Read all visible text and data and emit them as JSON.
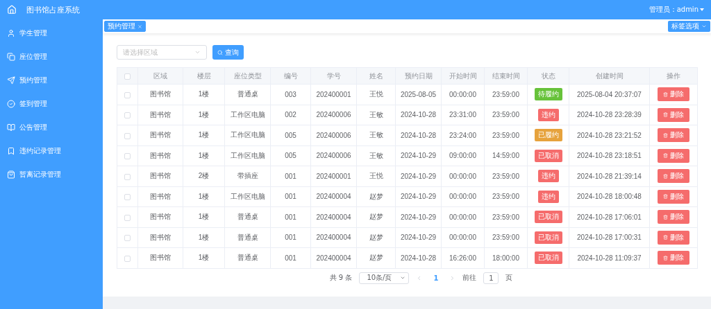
{
  "header": {
    "title": "图书馆占座系统",
    "user": "管理员：admin"
  },
  "sidebar": {
    "items": [
      {
        "label": "学生管理"
      },
      {
        "label": "座位管理"
      },
      {
        "label": "预约管理"
      },
      {
        "label": "签到管理"
      },
      {
        "label": "公告管理"
      },
      {
        "label": "违约记录管理"
      },
      {
        "label": "暂离记录管理"
      }
    ]
  },
  "tabs": [
    {
      "label": "预约管理",
      "selected": true
    }
  ],
  "tab_options": "标签选项",
  "filter": {
    "placeholder": "请选择区域",
    "search_button": "查询"
  },
  "table": {
    "header_checked": false,
    "columns": [
      "区域",
      "楼层",
      "座位类型",
      "编号",
      "学号",
      "姓名",
      "预约日期",
      "开始时间",
      "结束时间",
      "状态",
      "创建时间",
      "操作"
    ],
    "rows": [
      {
        "checked": false,
        "cells": [
          "图书馆",
          "1楼",
          "普通桌",
          "003",
          "202400001",
          "王悦",
          "2025-08-05",
          "00:00:00",
          "23:59:00"
        ],
        "status": "待履约",
        "color": "#67c23a",
        "created": "2025-08-04 20:37:07",
        "action": "删除"
      },
      {
        "checked": false,
        "cells": [
          "图书馆",
          "1楼",
          "工作区电脑",
          "002",
          "202400006",
          "王敏",
          "2024-10-28",
          "23:31:00",
          "23:59:00"
        ],
        "status": "违约",
        "color": "#f56c6c",
        "created": "2024-10-28 23:28:39",
        "action": "删除"
      },
      {
        "checked": false,
        "cells": [
          "图书馆",
          "1楼",
          "工作区电脑",
          "005",
          "202400006",
          "王敏",
          "2024-10-28",
          "23:24:00",
          "23:59:00"
        ],
        "status": "已履约",
        "color": "#e6a23c",
        "created": "2024-10-28 23:21:52",
        "action": "删除"
      },
      {
        "checked": false,
        "cells": [
          "图书馆",
          "1楼",
          "工作区电脑",
          "005",
          "202400006",
          "王敏",
          "2024-10-29",
          "09:00:00",
          "14:59:00"
        ],
        "status": "已取消",
        "color": "#f56c6c",
        "created": "2024-10-28 23:18:51",
        "action": "删除"
      },
      {
        "checked": false,
        "cells": [
          "图书馆",
          "2楼",
          "带插座",
          "001",
          "202400001",
          "王悦",
          "2024-10-29",
          "00:00:00",
          "23:59:00"
        ],
        "status": "违约",
        "color": "#f56c6c",
        "created": "2024-10-28 21:39:14",
        "action": "删除"
      },
      {
        "checked": false,
        "cells": [
          "图书馆",
          "1楼",
          "工作区电脑",
          "001",
          "202400004",
          "赵梦",
          "2024-10-29",
          "00:00:00",
          "23:59:00"
        ],
        "status": "违约",
        "color": "#f56c6c",
        "created": "2024-10-28 18:00:48",
        "action": "删除"
      },
      {
        "checked": false,
        "cells": [
          "图书馆",
          "1楼",
          "普通桌",
          "001",
          "202400004",
          "赵梦",
          "2024-10-29",
          "00:00:00",
          "23:59:00"
        ],
        "status": "已取消",
        "color": "#f56c6c",
        "created": "2024-10-28 17:06:01",
        "action": "删除"
      },
      {
        "checked": false,
        "cells": [
          "图书馆",
          "1楼",
          "普通桌",
          "001",
          "202400004",
          "赵梦",
          "2024-10-29",
          "00:00:00",
          "23:59:00"
        ],
        "status": "已取消",
        "color": "#f56c6c",
        "created": "2024-10-28 17:00:31",
        "action": "删除"
      },
      {
        "checked": false,
        "cells": [
          "图书馆",
          "1楼",
          "普通桌",
          "001",
          "202400004",
          "赵梦",
          "2024-10-28",
          "16:26:00",
          "18:00:00"
        ],
        "status": "已取消",
        "color": "#f56c6c",
        "created": "2024-10-28 11:09:37",
        "action": "删除"
      }
    ]
  },
  "pagination": {
    "total": "共 9 条",
    "page_size": "10条/页",
    "pages": [
      {
        "label": "1",
        "selected": true
      }
    ],
    "goto_label": "前往",
    "goto_value": "1",
    "goto_suffix": "页"
  }
}
